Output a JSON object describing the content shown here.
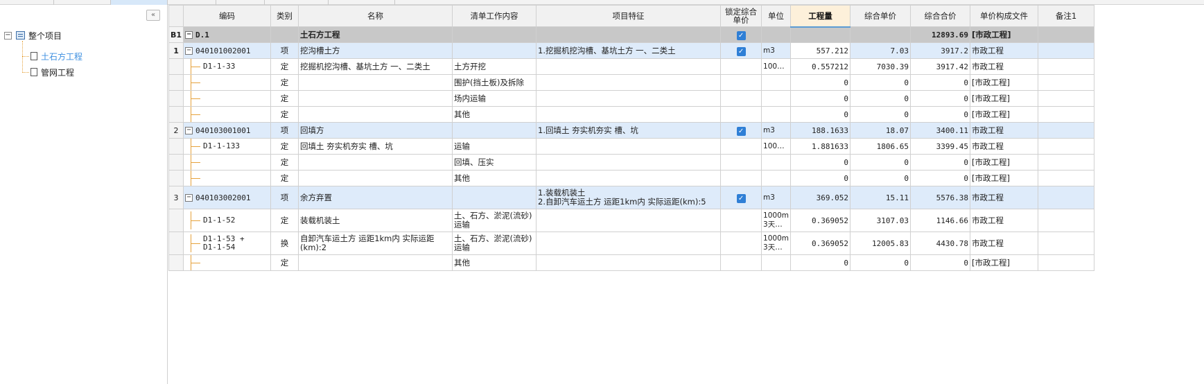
{
  "tree": {
    "root": "整个项目",
    "children": [
      "土石方工程",
      "管网工程"
    ]
  },
  "grid": {
    "headers": [
      "编码",
      "类别",
      "名称",
      "清单工作内容",
      "项目特征",
      "锁定综合单价",
      "单位",
      "工程量",
      "综合单价",
      "综合合价",
      "单价构成文件",
      "备注1"
    ],
    "section": {
      "rn": "B1",
      "code": "D.1",
      "name": "土石方工程",
      "total": "12893.69",
      "file": "[市政工程]"
    },
    "rows": [
      {
        "type": "item",
        "sel": true,
        "rn": "1",
        "code": "040101002001",
        "cat": "项",
        "name": "挖沟槽土方",
        "work": "",
        "feat": "1.挖掘机挖沟槽、基坑土方 一、二类土",
        "lock": true,
        "unit": "m3",
        "qty": "557.212",
        "price": "7.03",
        "total": "3917.2",
        "file": "市政工程"
      },
      {
        "type": "sub",
        "code": "D1-1-33",
        "cat": "定",
        "name": "挖掘机挖沟槽、基坑土方 一、二类土",
        "work": "土方开挖",
        "feat": "",
        "unit": "100…",
        "qty": "0.557212",
        "price": "7030.39",
        "total": "3917.42",
        "file": "市政工程"
      },
      {
        "type": "sub",
        "code": "",
        "cat": "定",
        "name": "",
        "work": "围护(挡土板)及拆除",
        "feat": "",
        "unit": "",
        "qty": "0",
        "price": "0",
        "total": "0",
        "file": "[市政工程]"
      },
      {
        "type": "sub",
        "code": "",
        "cat": "定",
        "name": "",
        "work": "场内运输",
        "feat": "",
        "unit": "",
        "qty": "0",
        "price": "0",
        "total": "0",
        "file": "[市政工程]"
      },
      {
        "type": "sub",
        "code": "",
        "cat": "定",
        "name": "",
        "work": "其他",
        "feat": "",
        "unit": "",
        "qty": "0",
        "price": "0",
        "total": "0",
        "file": "[市政工程]"
      },
      {
        "type": "item",
        "rn": "2",
        "code": "040103001001",
        "cat": "项",
        "name": "回填方",
        "work": "",
        "feat": "1.回填土 夯实机夯实 槽、坑",
        "lock": true,
        "unit": "m3",
        "qty": "188.1633",
        "price": "18.07",
        "total": "3400.11",
        "file": "市政工程"
      },
      {
        "type": "sub",
        "code": "D1-1-133",
        "cat": "定",
        "name": "回填土 夯实机夯实 槽、坑",
        "work": "运输",
        "feat": "",
        "unit": "100…",
        "qty": "1.881633",
        "price": "1806.65",
        "total": "3399.45",
        "file": "市政工程"
      },
      {
        "type": "sub",
        "code": "",
        "cat": "定",
        "name": "",
        "work": "回填、压实",
        "feat": "",
        "unit": "",
        "qty": "0",
        "price": "0",
        "total": "0",
        "file": "[市政工程]"
      },
      {
        "type": "sub",
        "code": "",
        "cat": "定",
        "name": "",
        "work": "其他",
        "feat": "",
        "unit": "",
        "qty": "0",
        "price": "0",
        "total": "0",
        "file": "[市政工程]"
      },
      {
        "type": "item",
        "tall": true,
        "rn": "3",
        "code": "040103002001",
        "cat": "项",
        "name": "余方弃置",
        "work": "",
        "feat": "1.装载机装土\n2.自卸汽车运土方 运距1km内  实际运距(km):5",
        "lock": true,
        "unit": "m3",
        "qty": "369.052",
        "price": "15.11",
        "total": "5576.38",
        "file": "市政工程"
      },
      {
        "type": "sub",
        "tall": true,
        "code": "D1-1-52",
        "cat": "定",
        "name": "装载机装土",
        "work": "土、石方、淤泥(流砂)运输",
        "feat": "",
        "unit": "1000m\n3天…",
        "qty": "0.369052",
        "price": "3107.03",
        "total": "1146.66",
        "file": "市政工程"
      },
      {
        "type": "sub",
        "tall": true,
        "code": "D1-1-53 +\nD1-1-54",
        "cat": "换",
        "name": "自卸汽车运土方 运距1km内  实际运距(km):2",
        "work": "土、石方、淤泥(流砂)运输",
        "feat": "",
        "unit": "1000m\n3天…",
        "qty": "0.369052",
        "price": "12005.83",
        "total": "4430.78",
        "file": "市政工程"
      },
      {
        "type": "sub",
        "code": "",
        "cat": "定",
        "name": "",
        "work": "其他",
        "feat": "",
        "unit": "",
        "qty": "0",
        "price": "0",
        "total": "0",
        "file": "[市政工程]"
      }
    ]
  },
  "icons": {
    "collapse": "double-chevron-left-icon",
    "check": "checkbox-checked-icon"
  },
  "colors": {
    "selected_row": "#9ccbf3",
    "item_row": "#deebfa",
    "section_row": "#c8c8c8",
    "tree_active": "#3d8fe0",
    "tree_line": "#e6a23c"
  }
}
